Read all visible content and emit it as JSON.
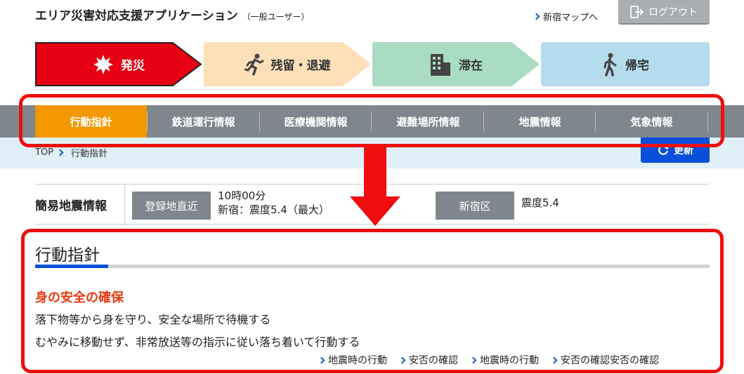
{
  "header": {
    "title": "エリア災害対応支援アプリケーション",
    "subtitle": "（一般ユーザー）",
    "map_link": "新宿マップへ",
    "logout": "ログアウト"
  },
  "phases": [
    {
      "label": "発災",
      "icon": "burst-icon",
      "color": "#e60012"
    },
    {
      "label": "残留・退避",
      "icon": "running-person-icon",
      "color": "#fde0b8"
    },
    {
      "label": "滞在",
      "icon": "building-icon",
      "color": "#a9dcc0"
    },
    {
      "label": "帰宅",
      "icon": "walking-person-icon",
      "color": "#b4dcec"
    }
  ],
  "nav": {
    "items": [
      {
        "label": "行動指針",
        "active": true
      },
      {
        "label": "鉄道運行情報",
        "active": false
      },
      {
        "label": "医療機関情報",
        "active": false
      },
      {
        "label": "避難場所情報",
        "active": false
      },
      {
        "label": "地震情報",
        "active": false
      },
      {
        "label": "気象情報",
        "active": false
      }
    ],
    "active_color": "#f39800"
  },
  "breadcrumb": {
    "root": "TOP",
    "current": "行動指針",
    "refresh": "更新"
  },
  "quake": {
    "title": "簡易地震情報",
    "btn1": "登録地直近",
    "time": "10時00分",
    "detail": "新宿：震度5.4（最大）",
    "btn2": "新宿区",
    "ward_value": "震度5.4"
  },
  "action": {
    "title": "行動指針",
    "headline": "身の安全の確保",
    "line1": "落下物等から身を守り、安全な場所で待機する",
    "line2": "むやみに移動せず、非常放送等の指示に従い落ち着いて行動する",
    "links": [
      "地震時の行動",
      "安否の確認",
      "地震時の行動",
      "安否の確認安否の確認"
    ]
  },
  "colors": {
    "accent_blue": "#0a4fd9",
    "alert_red": "#e8380d",
    "annotation_red": "#f00d0d"
  }
}
